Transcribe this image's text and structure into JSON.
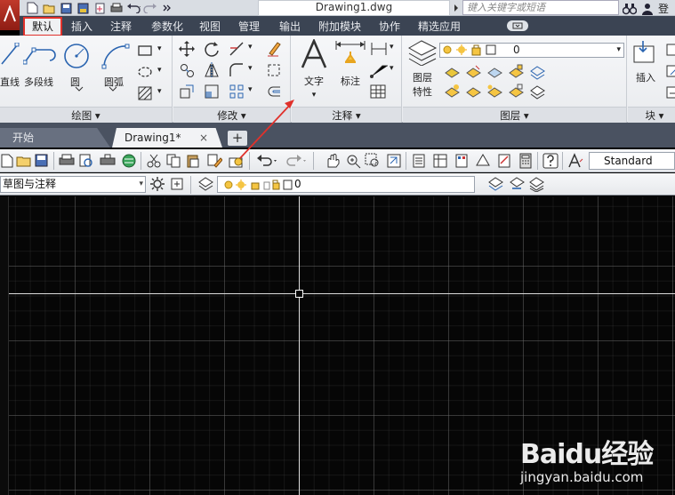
{
  "window": {
    "document_title": "Drawing1.dwg",
    "search_placeholder": "键入关键字或短语",
    "signin_label": "登"
  },
  "ribbon_tabs": [
    {
      "label": "默认",
      "active": true
    },
    {
      "label": "插入"
    },
    {
      "label": "注释"
    },
    {
      "label": "参数化"
    },
    {
      "label": "视图"
    },
    {
      "label": "管理"
    },
    {
      "label": "输出"
    },
    {
      "label": "附加模块"
    },
    {
      "label": "协作"
    },
    {
      "label": "精选应用"
    }
  ],
  "ribbon": {
    "draw": {
      "title": "绘图",
      "line_label": "直线",
      "polyline_label": "多段线",
      "circle_label": "圆",
      "arc_label": "圆弧"
    },
    "modify": {
      "title": "修改"
    },
    "annotation": {
      "title": "注释",
      "text_label": "文字",
      "dimension_label": "标注"
    },
    "layers": {
      "title": "图层",
      "properties_label_line1": "图层",
      "properties_label_line2": "特性",
      "current_layer": "0"
    },
    "block": {
      "title": "块",
      "insert_label": "插入"
    }
  },
  "document_tabs": {
    "start_label": "开始",
    "drawing_label": "Drawing1*",
    "close_glyph": "×",
    "new_tab_glyph": "+"
  },
  "toolbar": {
    "text_style": "Standard",
    "workspace": "草图与注释",
    "layer_value": "0"
  },
  "watermark": {
    "logo": "Baidu经验",
    "url": "jingyan.baidu.com"
  },
  "colors": {
    "annotation_red": "#e0312b",
    "canvas_bg": "#060606",
    "tab_bar_bg": "#3b4453"
  }
}
